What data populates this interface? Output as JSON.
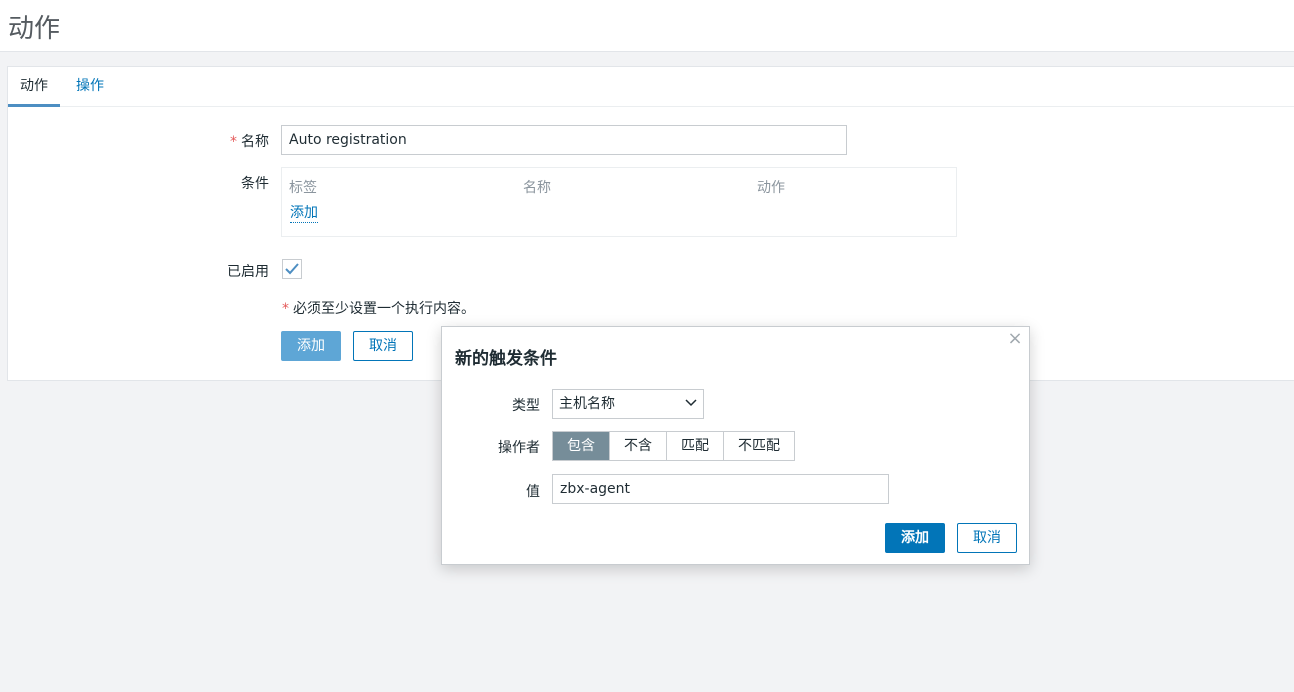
{
  "page": {
    "title": "动作"
  },
  "tabs": [
    {
      "label": "动作",
      "active": true
    },
    {
      "label": "操作",
      "active": false
    }
  ],
  "form": {
    "name_label": "名称",
    "name_value": "Auto registration",
    "required_mark": "*",
    "conditions_label": "条件",
    "conditions_table": {
      "headers": [
        "标签",
        "名称",
        "动作"
      ],
      "add_link": "添加"
    },
    "enabled_label": "已启用",
    "enabled": true,
    "hint": "必须至少设置一个执行内容。",
    "add_button": "添加",
    "cancel_button": "取消"
  },
  "dialog": {
    "title": "新的触发条件",
    "close_icon": "close-icon",
    "type_label": "类型",
    "type_value": "主机名称",
    "operator_label": "操作者",
    "operators": [
      {
        "label": "包含",
        "selected": true
      },
      {
        "label": "不含",
        "selected": false
      },
      {
        "label": "匹配",
        "selected": false
      },
      {
        "label": "不匹配",
        "selected": false
      }
    ],
    "value_label": "值",
    "value": "zbx-agent",
    "add_button": "添加",
    "cancel_button": "取消"
  },
  "colors": {
    "accent": "#0275b8",
    "selected_segment": "#768d99",
    "required": "#e45959",
    "background": "#f2f3f5"
  }
}
